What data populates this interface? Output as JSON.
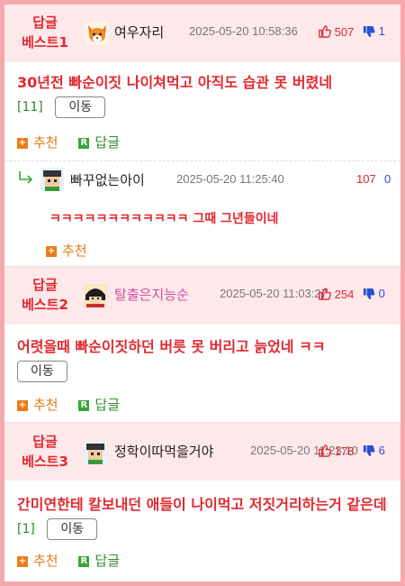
{
  "best_label_line1": "답글",
  "posts": [
    {
      "rank_line2": "베스트1",
      "nickname": "여우자리",
      "date": "2025-05-20 10:58:36",
      "up": "507",
      "down": "1",
      "title": "30년전 빠순이짓 나이쳐먹고 아직도 습관 못 버렸네",
      "count": "[11]",
      "move": "이동",
      "recommend": "추천",
      "reply": "답글",
      "sub_reply": {
        "nickname": "빠꾸없는아이",
        "date": "2025-05-20 11:25:40",
        "up": "107",
        "down": "0",
        "text": "ㅋㅋㅋㅋㅋㅋㅋㅋㅋㅋㅋㅋ 그때 그년들이네",
        "recommend": "추천"
      }
    },
    {
      "rank_line2": "베스트2",
      "nickname": "탈출은지능순",
      "date": "2025-05-20 11:03:27",
      "up": "254",
      "down": "0",
      "title": "어렷을때 빠순이짓하던 버릇 못 버리고 늙었네 ㅋㅋ",
      "count": "",
      "move": "이동",
      "recommend": "추천",
      "reply": "답글"
    },
    {
      "rank_line2": "베스트3",
      "nickname": "정학이따먹을거야",
      "date": "2025-05-20 11:23:10",
      "up": "178",
      "down": "6",
      "title": "간미연한테 칼보내던 애들이 나이먹고 저짓거리하는거 같은데",
      "count": "[1]",
      "move": "이동",
      "recommend": "추천",
      "reply": "답글"
    }
  ],
  "icons": {
    "up": "thumb-up-icon",
    "down": "thumb-down-icon",
    "recommend": "plus-icon",
    "reply": "reply-r-icon",
    "sub_arrow": "reply-arrow-icon"
  }
}
